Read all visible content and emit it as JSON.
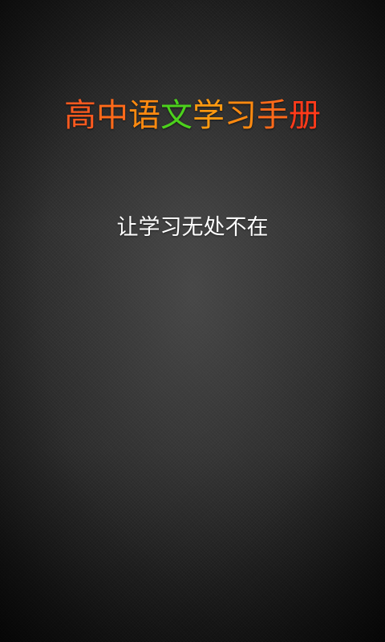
{
  "splash": {
    "title_chars": [
      {
        "char": "高",
        "color": "#ff5a1f"
      },
      {
        "char": "中",
        "color": "#ff6a1a"
      },
      {
        "char": "语",
        "color": "#ff8a10"
      },
      {
        "char": "文",
        "color": "#4cd11c"
      },
      {
        "char": "学",
        "color": "#ff9a10"
      },
      {
        "char": "习",
        "color": "#ff8a10"
      },
      {
        "char": "手",
        "color": "#ff6a1a"
      },
      {
        "char": "册",
        "color": "#ff3a1a"
      }
    ],
    "tagline": "让学习无处不在"
  },
  "colors": {
    "background": "#2b2b2b",
    "tagline": "#ffffff"
  }
}
